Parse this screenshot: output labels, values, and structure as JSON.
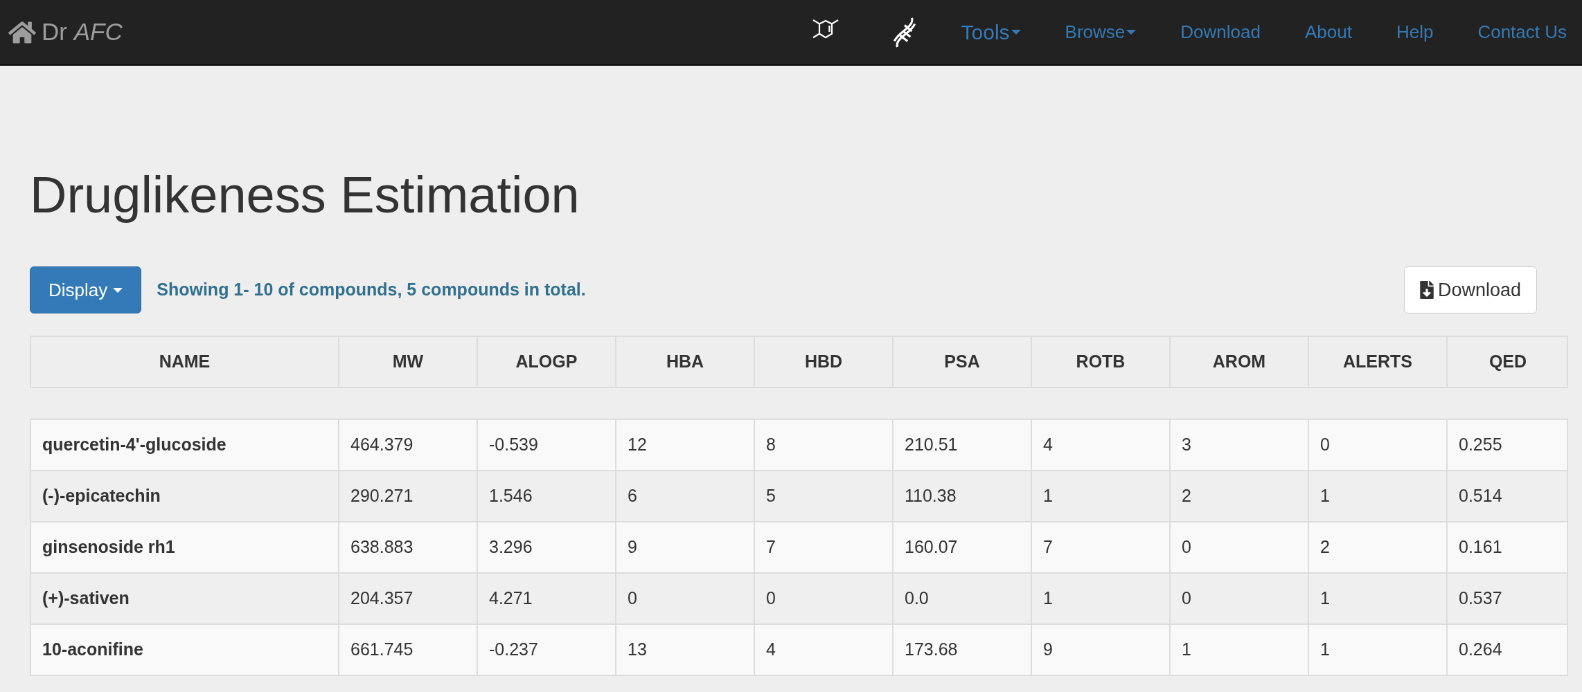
{
  "navbar": {
    "brand": "Dr *AFC*",
    "links": [
      {
        "label": "Tools",
        "kind": "dropdown"
      },
      {
        "label": "Browse",
        "kind": "dropdown"
      },
      {
        "label": "Download",
        "kind": "link"
      },
      {
        "label": "About",
        "kind": "link"
      },
      {
        "label": "Help",
        "kind": "link"
      },
      {
        "label": "Contact Us",
        "kind": "link"
      }
    ]
  },
  "page": {
    "title": "Druglikeness Estimation",
    "display_button": "Display",
    "summary": "Showing 1- 10 of compounds, 5 compounds in total.",
    "download_button": "Download"
  },
  "table": {
    "columns": [
      "NAME",
      "MW",
      "ALOGP",
      "HBA",
      "HBD",
      "PSA",
      "ROTB",
      "AROM",
      "ALERTS",
      "QED"
    ],
    "rows": [
      [
        "quercetin-4'-glucoside",
        "464.379",
        "-0.539",
        "12",
        "8",
        "210.51",
        "4",
        "3",
        "0",
        "0.255"
      ],
      [
        "(-)-epicatechin",
        "290.271",
        "1.546",
        "6",
        "5",
        "110.38",
        "1",
        "2",
        "1",
        "0.514"
      ],
      [
        "ginsenoside rh1",
        "638.883",
        "3.296",
        "9",
        "7",
        "160.07",
        "7",
        "0",
        "2",
        "0.161"
      ],
      [
        "(+)-sativen",
        "204.357",
        "4.271",
        "0",
        "0",
        "0.0",
        "1",
        "0",
        "1",
        "0.537"
      ],
      [
        "10-aconifine",
        "661.745",
        "-0.237",
        "13",
        "4",
        "173.68",
        "9",
        "1",
        "1",
        "0.264"
      ]
    ]
  }
}
